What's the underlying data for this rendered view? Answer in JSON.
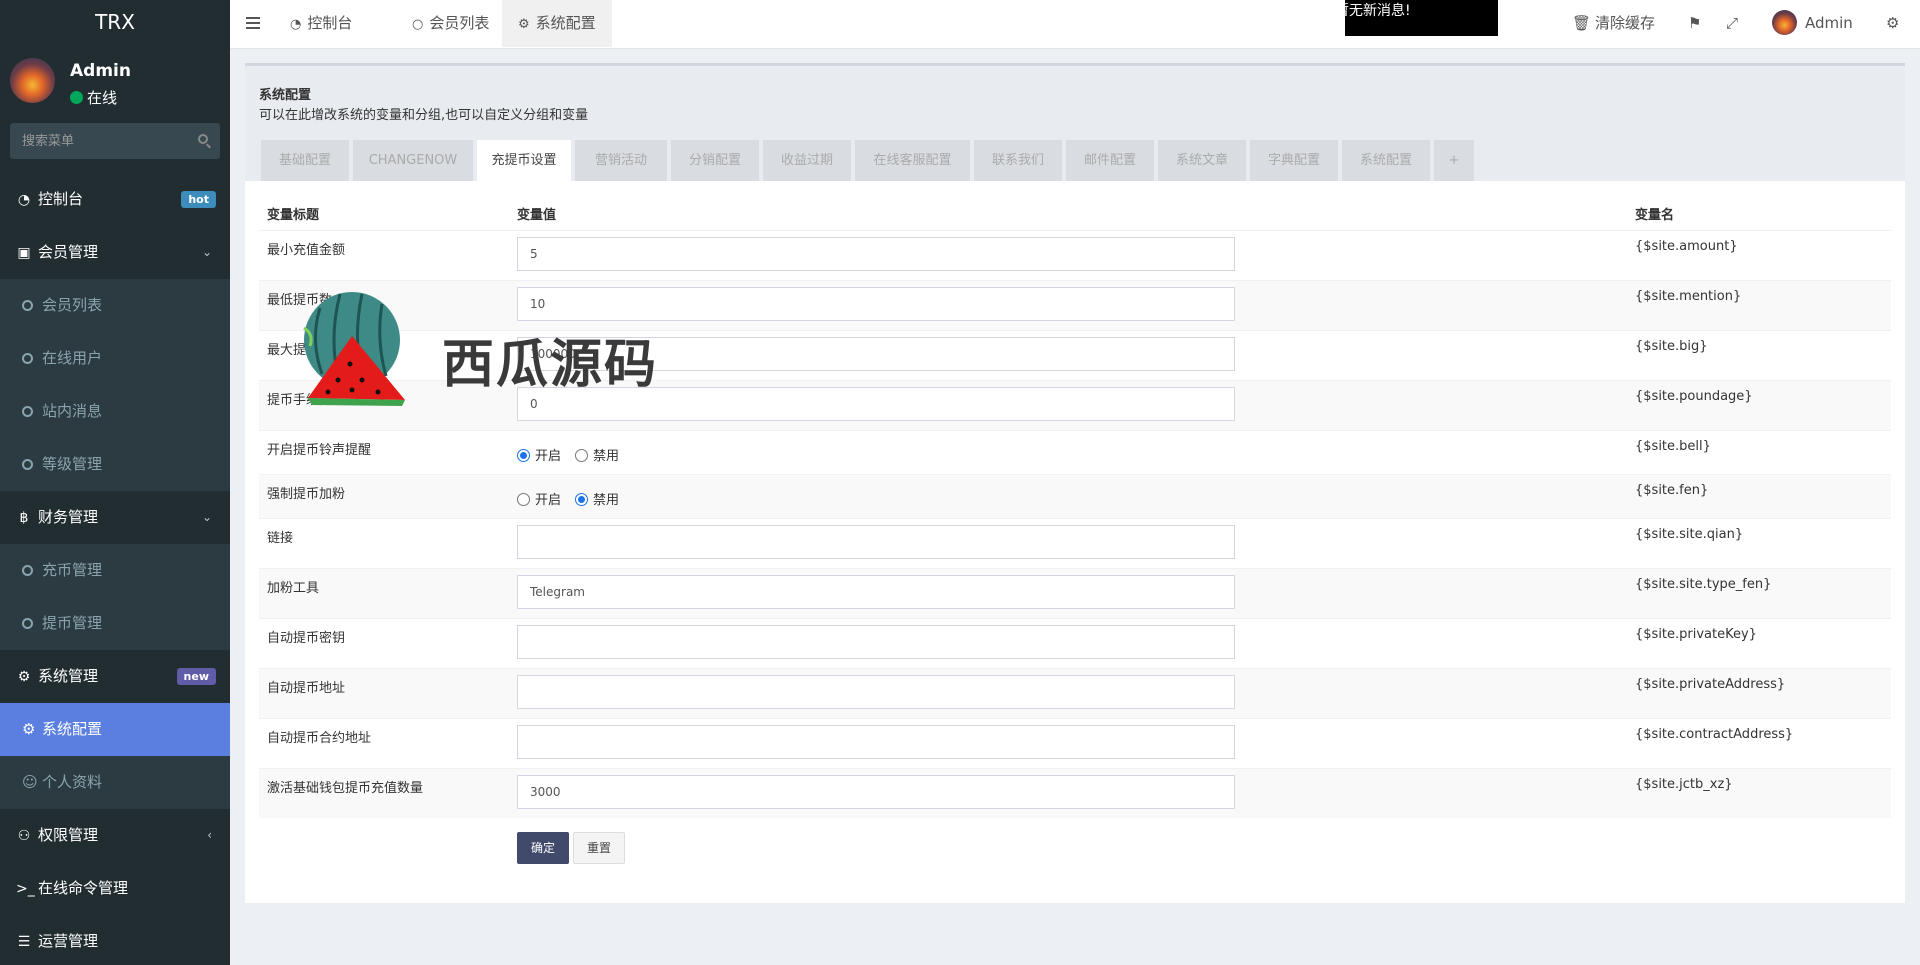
{
  "sidebar": {
    "logo": "TRX",
    "user": {
      "name": "Admin",
      "status": "在线"
    },
    "search_placeholder": "搜索菜单",
    "menu": [
      {
        "label": "控制台",
        "icon": "dashboard-icon",
        "badge": "hot"
      },
      {
        "label": "会员管理",
        "icon": "member-card-icon"
      },
      {
        "label": "会员列表",
        "sub": true
      },
      {
        "label": "在线用户",
        "sub": true
      },
      {
        "label": "站内消息",
        "sub": true
      },
      {
        "label": "等级管理",
        "sub": true
      },
      {
        "label": "财务管理",
        "icon": "bitcoin-icon"
      },
      {
        "label": "充币管理",
        "sub": true
      },
      {
        "label": "提币管理",
        "sub": true
      },
      {
        "label": "系统管理",
        "icon": "gears-icon",
        "badge": "new"
      },
      {
        "label": "系统配置",
        "sub": true,
        "active": true
      },
      {
        "label": "个人资料",
        "sub": true
      },
      {
        "label": "权限管理",
        "icon": "users-icon"
      },
      {
        "label": "在线命令管理",
        "icon": "terminal-icon"
      },
      {
        "label": "运营管理",
        "icon": "list-icon"
      }
    ]
  },
  "header": {
    "tabs": [
      {
        "label": "控制台"
      },
      {
        "label": "会员列表"
      },
      {
        "label": "系统配置"
      }
    ],
    "notice": "暂无新消息!",
    "clear_cache": "清除缓存",
    "admin": "Admin"
  },
  "panel": {
    "title": "系统配置",
    "subtitle": "可以在此增改系统的变量和分组,也可以自定义分组和变量",
    "tabs": [
      "基础配置",
      "CHANGENOW",
      "充提币设置",
      "营销活动",
      "分销配置",
      "收益过期",
      "在线客服配置",
      "联系我们",
      "邮件配置",
      "系统文章",
      "字典配置",
      "系统配置",
      "+"
    ],
    "active_tab": 2
  },
  "table": {
    "headers": {
      "title": "变量标题",
      "value": "变量值",
      "name": "变量名"
    },
    "rows": [
      {
        "title": "最小充值金额",
        "type": "input",
        "value": "5",
        "name": "{$site.amount}"
      },
      {
        "title": "最低提币数",
        "type": "input",
        "value": "10",
        "name": "{$site.mention}"
      },
      {
        "title": "最大提币数",
        "type": "input",
        "value": "100000",
        "name": "{$site.big}"
      },
      {
        "title": "提币手续费",
        "type": "input",
        "value": "0",
        "name": "{$site.poundage}"
      },
      {
        "title": "开启提币铃声提醒",
        "type": "radio",
        "options": [
          "开启",
          "禁用"
        ],
        "selected": 0,
        "name": "{$site.bell}"
      },
      {
        "title": "强制提币加粉",
        "type": "radio",
        "options": [
          "开启",
          "禁用"
        ],
        "selected": 1,
        "name": "{$site.fen}"
      },
      {
        "title": "链接",
        "type": "input",
        "value": "",
        "name": "{$site.site.qian}"
      },
      {
        "title": "加粉工具",
        "type": "input",
        "value": "Telegram",
        "name": "{$site.site.type_fen}"
      },
      {
        "title": "自动提币密钥",
        "type": "input",
        "value": "",
        "name": "{$site.privateKey}"
      },
      {
        "title": "自动提币地址",
        "type": "input",
        "value": "",
        "name": "{$site.privateAddress}"
      },
      {
        "title": "自动提币合约地址",
        "type": "input",
        "value": "",
        "name": "{$site.contractAddress}"
      },
      {
        "title": "激活基础钱包提币充值数量",
        "type": "input",
        "value": "3000",
        "name": "{$site.jctb_xz}"
      }
    ],
    "submit": "确定",
    "reset": "重置"
  },
  "watermark": {
    "text": "西瓜源码"
  }
}
